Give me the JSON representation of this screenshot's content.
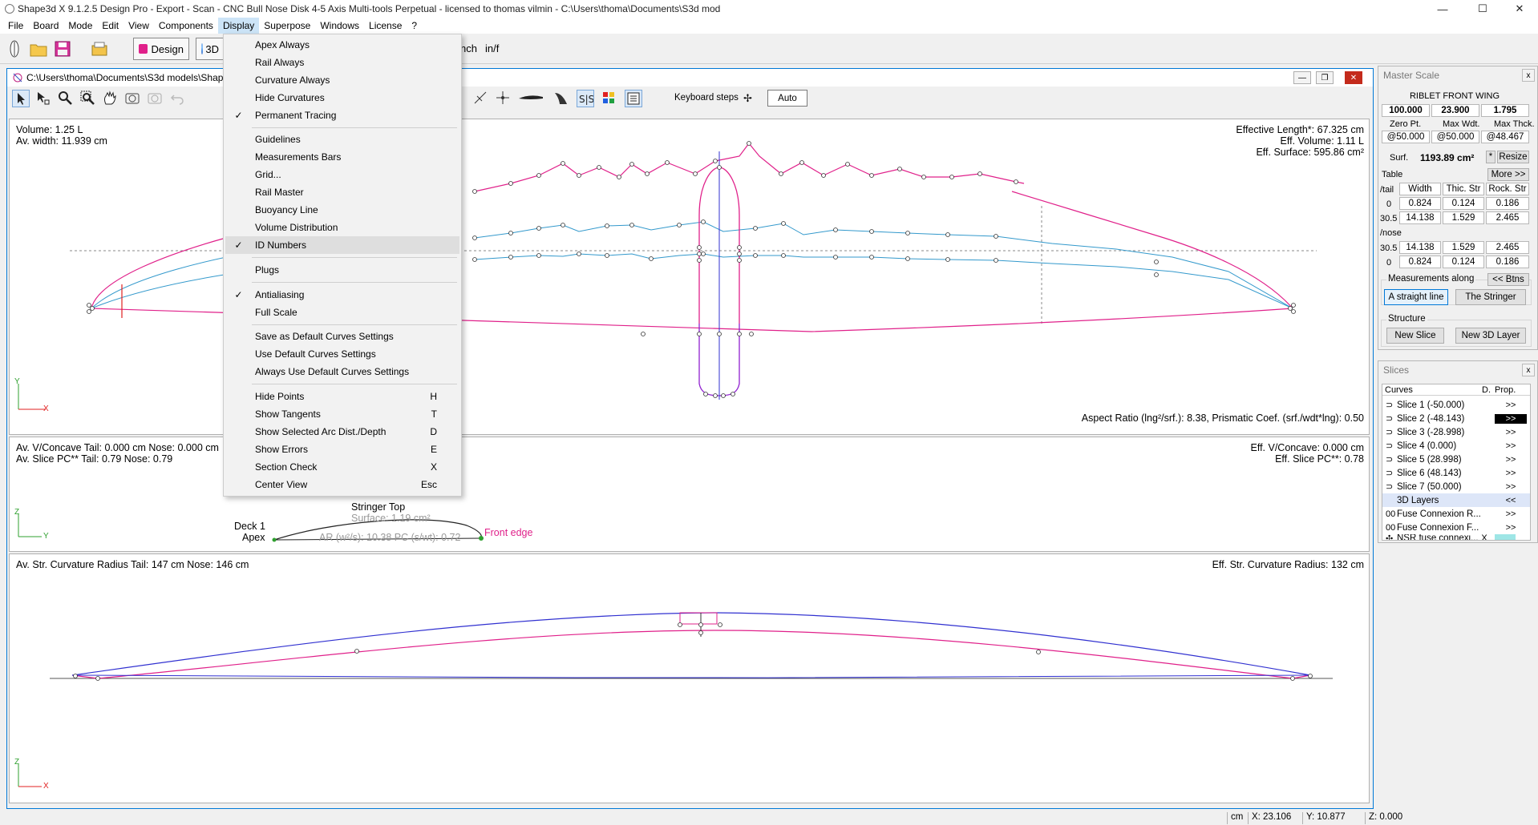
{
  "window": {
    "title": "Shape3d X 9.1.2.5 Design Pro - Export - Scan - CNC Bull Nose Disk 4-5 Axis Multi-tools Perpetual - licensed to thomas vilmin - C:\\Users\\thoma\\Documents\\S3d mod",
    "minimize": "—",
    "maximize": "☐",
    "close": "✕"
  },
  "menubar": [
    "File",
    "Board",
    "Mode",
    "Edit",
    "View",
    "Components",
    "Display",
    "Superpose",
    "Windows",
    "License",
    "?"
  ],
  "toolbar": {
    "design_label": "Design",
    "mode3d_label": "3D",
    "unit_fragment": "nch",
    "unit_label": "in/f"
  },
  "document": {
    "path": "C:\\Users\\thoma\\Documents\\S3d models\\Shap",
    "keyboard_steps_label": "Keyboard steps",
    "auto_label": "Auto"
  },
  "top_view": {
    "volume": "Volume:   1.25 L",
    "av_width": "Av. width:  11.939 cm",
    "eff_length": "Effective Length*: 67.325 cm",
    "eff_volume": "Eff. Volume:   1.11 L",
    "eff_surface": "Eff. Surface: 595.86 cm²",
    "aspect_ratio": "Aspect Ratio (lng²/srf.):  8.38, Prismatic Coef. (srf./wdt*lng):  0.50",
    "axis_y": "Y",
    "axis_x": "X"
  },
  "slice_view": {
    "concave": "Av. V/Concave Tail: 0.000 cm Nose: 0.000 cm",
    "slice_pc": "Av. Slice PC** Tail:  0.79 Nose:  0.79",
    "eff_concave": "Eff. V/Concave: 0.000 cm",
    "eff_slice_pc": "Eff. Slice PC**:  0.78",
    "stringer_top": "Stringer Top",
    "surface": "Surface:  1.19 cm²",
    "deck": "Deck 1",
    "apex": "Apex",
    "ar": "AR (w²/s): 10.38 PC (s/wt): 0.72",
    "front_edge": "Front edge",
    "axis_z": "Z",
    "axis_y": "Y"
  },
  "side_view": {
    "curvature": "Av. Str. Curvature Radius Tail: 147 cm Nose: 146 cm",
    "eff_curvature": "Eff. Str. Curvature Radius: 132 cm",
    "axis_z": "Z",
    "axis_x": "X"
  },
  "master_scale": {
    "title": "Master Scale",
    "close": "x",
    "name": "RIBLET FRONT WING",
    "values": [
      "100.000",
      "23.900",
      "1.795"
    ],
    "labels": [
      "Zero Pt.",
      "Max Wdt.",
      "Max Thck."
    ],
    "positions": [
      "@50.000",
      "@50.000",
      "@48.467"
    ],
    "surf_label": "Surf.",
    "surf_value": "1193.89 cm²",
    "star": "*",
    "resize": "Resize",
    "table_label": "Table",
    "more": "More >>",
    "col_headers": [
      "Width",
      "Thic. Str",
      "Rock. Str"
    ],
    "tail_label": "/tail",
    "nose_label": "/nose",
    "tail_rows": [
      [
        "0",
        "0.824",
        "0.124",
        "0.186"
      ],
      [
        "30.5",
        "14.138",
        "1.529",
        "2.465"
      ]
    ],
    "nose_rows": [
      [
        "30.5",
        "14.138",
        "1.529",
        "2.465"
      ],
      [
        "0",
        "0.824",
        "0.124",
        "0.186"
      ]
    ],
    "measurements_label": "Measurements along",
    "btns": "<< Btns",
    "straight_line": "A straight line",
    "stringer": "The Stringer",
    "structure_label": "Structure",
    "new_slice": "New Slice",
    "new_3d_layer": "New 3D Layer"
  },
  "slices_panel": {
    "title": "Slices",
    "close": "x",
    "headers": [
      "Curves",
      "D.",
      "Prop."
    ],
    "items": [
      {
        "label": "Slice 1 (-50.000)",
        "arrow": ">>"
      },
      {
        "label": "Slice 2 (-48.143)",
        "arrow": ">>"
      },
      {
        "label": "Slice 3 (-28.998)",
        "arrow": ">>"
      },
      {
        "label": "Slice 4 (0.000)",
        "arrow": ">>"
      },
      {
        "label": "Slice 5 (28.998)",
        "arrow": ">>"
      },
      {
        "label": "Slice 6 (48.143)",
        "arrow": ">>"
      },
      {
        "label": "Slice 7 (50.000)",
        "arrow": ">>"
      },
      {
        "label": "3D Layers",
        "arrow": "<<"
      },
      {
        "label": "Fuse Connexion R...",
        "arrow": ">>"
      },
      {
        "label": "Fuse Connexion F...",
        "arrow": ">>"
      },
      {
        "label": "NSR fuse connexi...",
        "arrow": "X"
      }
    ]
  },
  "statusbar": {
    "unit": "cm",
    "x": "X: 23.106",
    "y": "Y: 10.877",
    "z": "Z: 0.000"
  },
  "display_menu": {
    "items": [
      {
        "label": "Apex Always",
        "checked": false,
        "shortcut": ""
      },
      {
        "label": "Rail Always",
        "checked": false,
        "shortcut": ""
      },
      {
        "label": "Curvature Always",
        "checked": false,
        "shortcut": ""
      },
      {
        "label": "Hide Curvatures",
        "checked": false,
        "shortcut": ""
      },
      {
        "label": "Permanent Tracing",
        "checked": true,
        "shortcut": ""
      },
      {
        "label": "Guidelines",
        "checked": false,
        "shortcut": ""
      },
      {
        "label": "Measurements Bars",
        "checked": false,
        "shortcut": ""
      },
      {
        "label": "Grid...",
        "checked": false,
        "shortcut": ""
      },
      {
        "label": "Rail Master",
        "checked": false,
        "shortcut": ""
      },
      {
        "label": "Buoyancy Line",
        "checked": false,
        "shortcut": ""
      },
      {
        "label": "Volume Distribution",
        "checked": false,
        "shortcut": ""
      },
      {
        "label": "ID Numbers",
        "checked": true,
        "shortcut": ""
      },
      {
        "label": "Plugs",
        "checked": false,
        "shortcut": ""
      },
      {
        "label": "Antialiasing",
        "checked": true,
        "shortcut": ""
      },
      {
        "label": "Full Scale",
        "checked": false,
        "shortcut": ""
      },
      {
        "label": "Save as Default Curves Settings",
        "checked": false,
        "shortcut": ""
      },
      {
        "label": "Use Default Curves Settings",
        "checked": false,
        "shortcut": ""
      },
      {
        "label": "Always Use Default Curves Settings",
        "checked": false,
        "shortcut": ""
      },
      {
        "label": "Hide Points",
        "checked": false,
        "shortcut": "H"
      },
      {
        "label": "Show Tangents",
        "checked": false,
        "shortcut": "T"
      },
      {
        "label": "Show Selected Arc Dist./Depth",
        "checked": false,
        "shortcut": "D"
      },
      {
        "label": "Show Errors",
        "checked": false,
        "shortcut": "E"
      },
      {
        "label": "Section Check",
        "checked": false,
        "shortcut": "X"
      },
      {
        "label": "Center View",
        "checked": false,
        "shortcut": "Esc"
      }
    ],
    "check_mark": "✓"
  },
  "colors": {
    "pink": "#e0208a",
    "blue_curve": "#3399cc",
    "dark_blue": "#3030d0",
    "purple": "#9020d0",
    "menu_highlight": "#cce4f7"
  }
}
